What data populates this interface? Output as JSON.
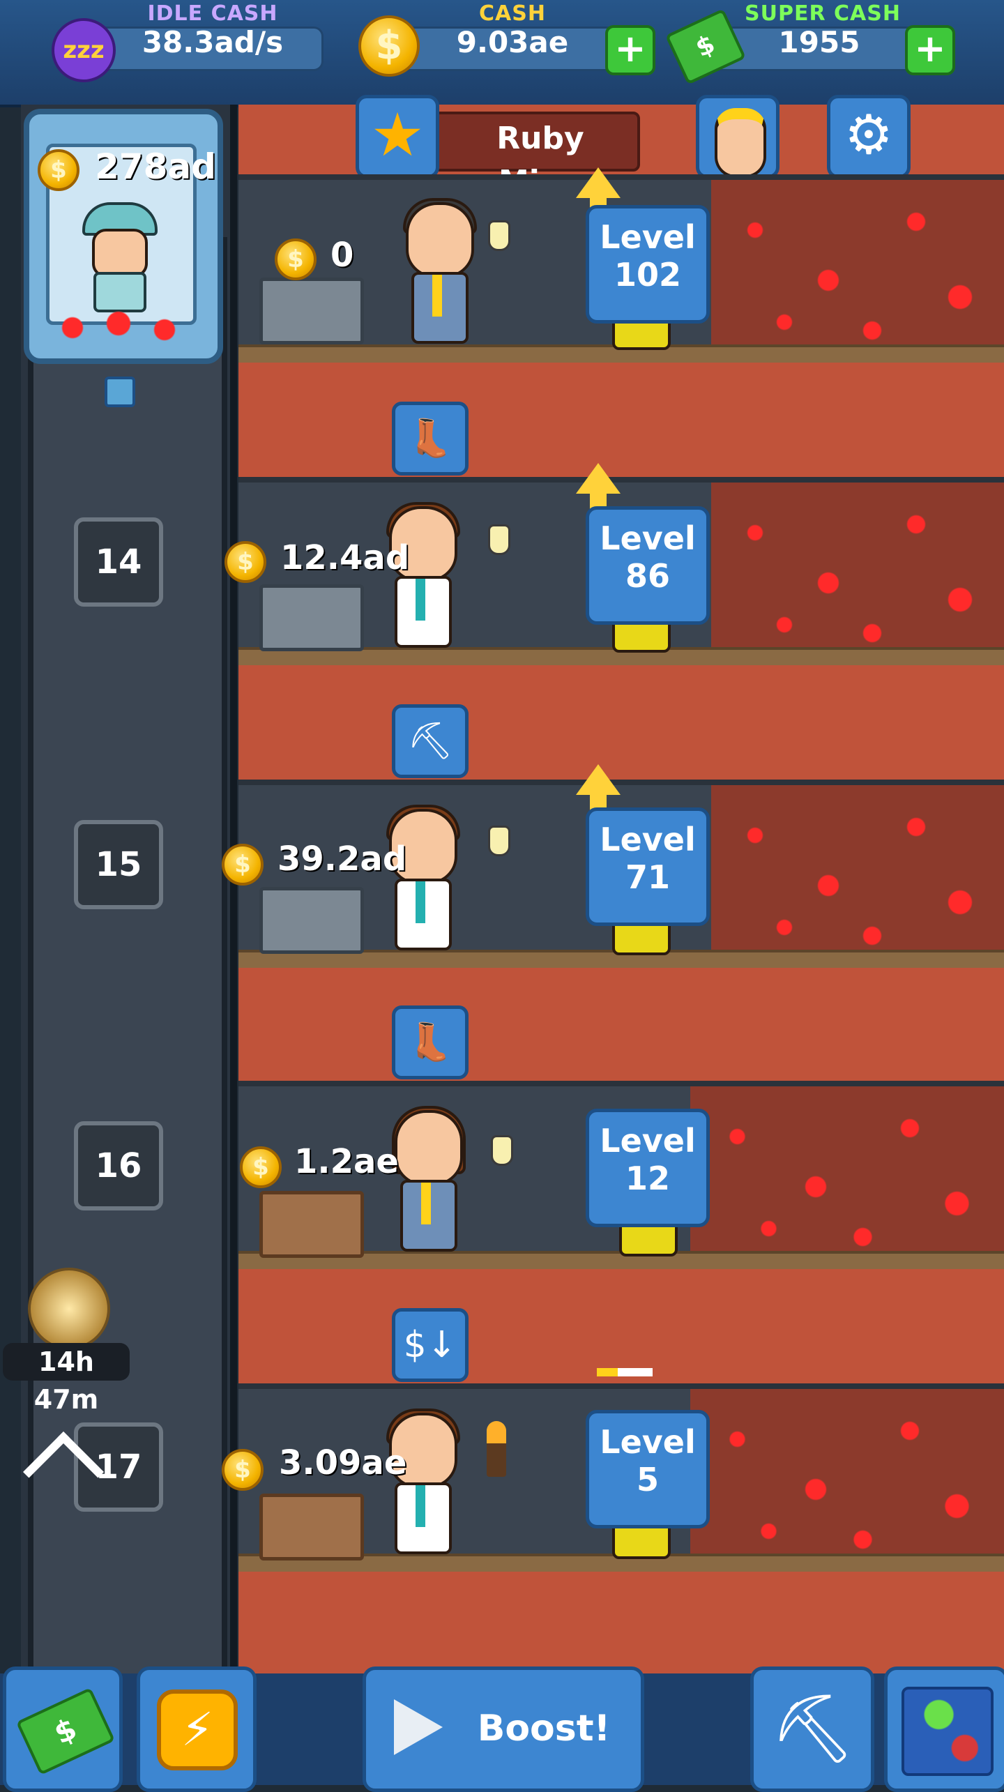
{
  "header": {
    "idle_cash": {
      "label": "IDLE CASH",
      "value": "38.3ad/s",
      "icon": "idle-zzz-icon"
    },
    "cash": {
      "label": "CASH",
      "value": "9.03ae",
      "icon": "coin-icon"
    },
    "super_cash": {
      "label": "SUPER CASH",
      "value": "1955",
      "icon": "super-cash-icon"
    },
    "plus_symbol": "+"
  },
  "mine": {
    "name": "Ruby Mine"
  },
  "elevator": {
    "storage": "278ad"
  },
  "shafts": [
    {
      "floor": "",
      "cash": "0",
      "level_label": "Level",
      "level": "102",
      "upgrade_available": true
    },
    {
      "floor": "14",
      "cash": "12.4ad",
      "level_label": "Level",
      "level": "86",
      "upgrade_available": true
    },
    {
      "floor": "15",
      "cash": "39.2ad",
      "level_label": "Level",
      "level": "71",
      "upgrade_available": true
    },
    {
      "floor": "16",
      "cash": "1.2ae",
      "level_label": "Level",
      "level": "12",
      "upgrade_available": false
    },
    {
      "floor": "17",
      "cash": "3.09ae",
      "level_label": "Level",
      "level": "5",
      "upgrade_available": false
    }
  ],
  "timer": {
    "value": "14h 47m"
  },
  "bottom_bar": {
    "boost_label": "Boost!"
  },
  "colors": {
    "idle_label": "#c8a8ff",
    "cash_label": "#ffd23a",
    "super_label": "#7dff5a",
    "dirt": "#c0533a",
    "panel_blue": "#3d86d1"
  }
}
